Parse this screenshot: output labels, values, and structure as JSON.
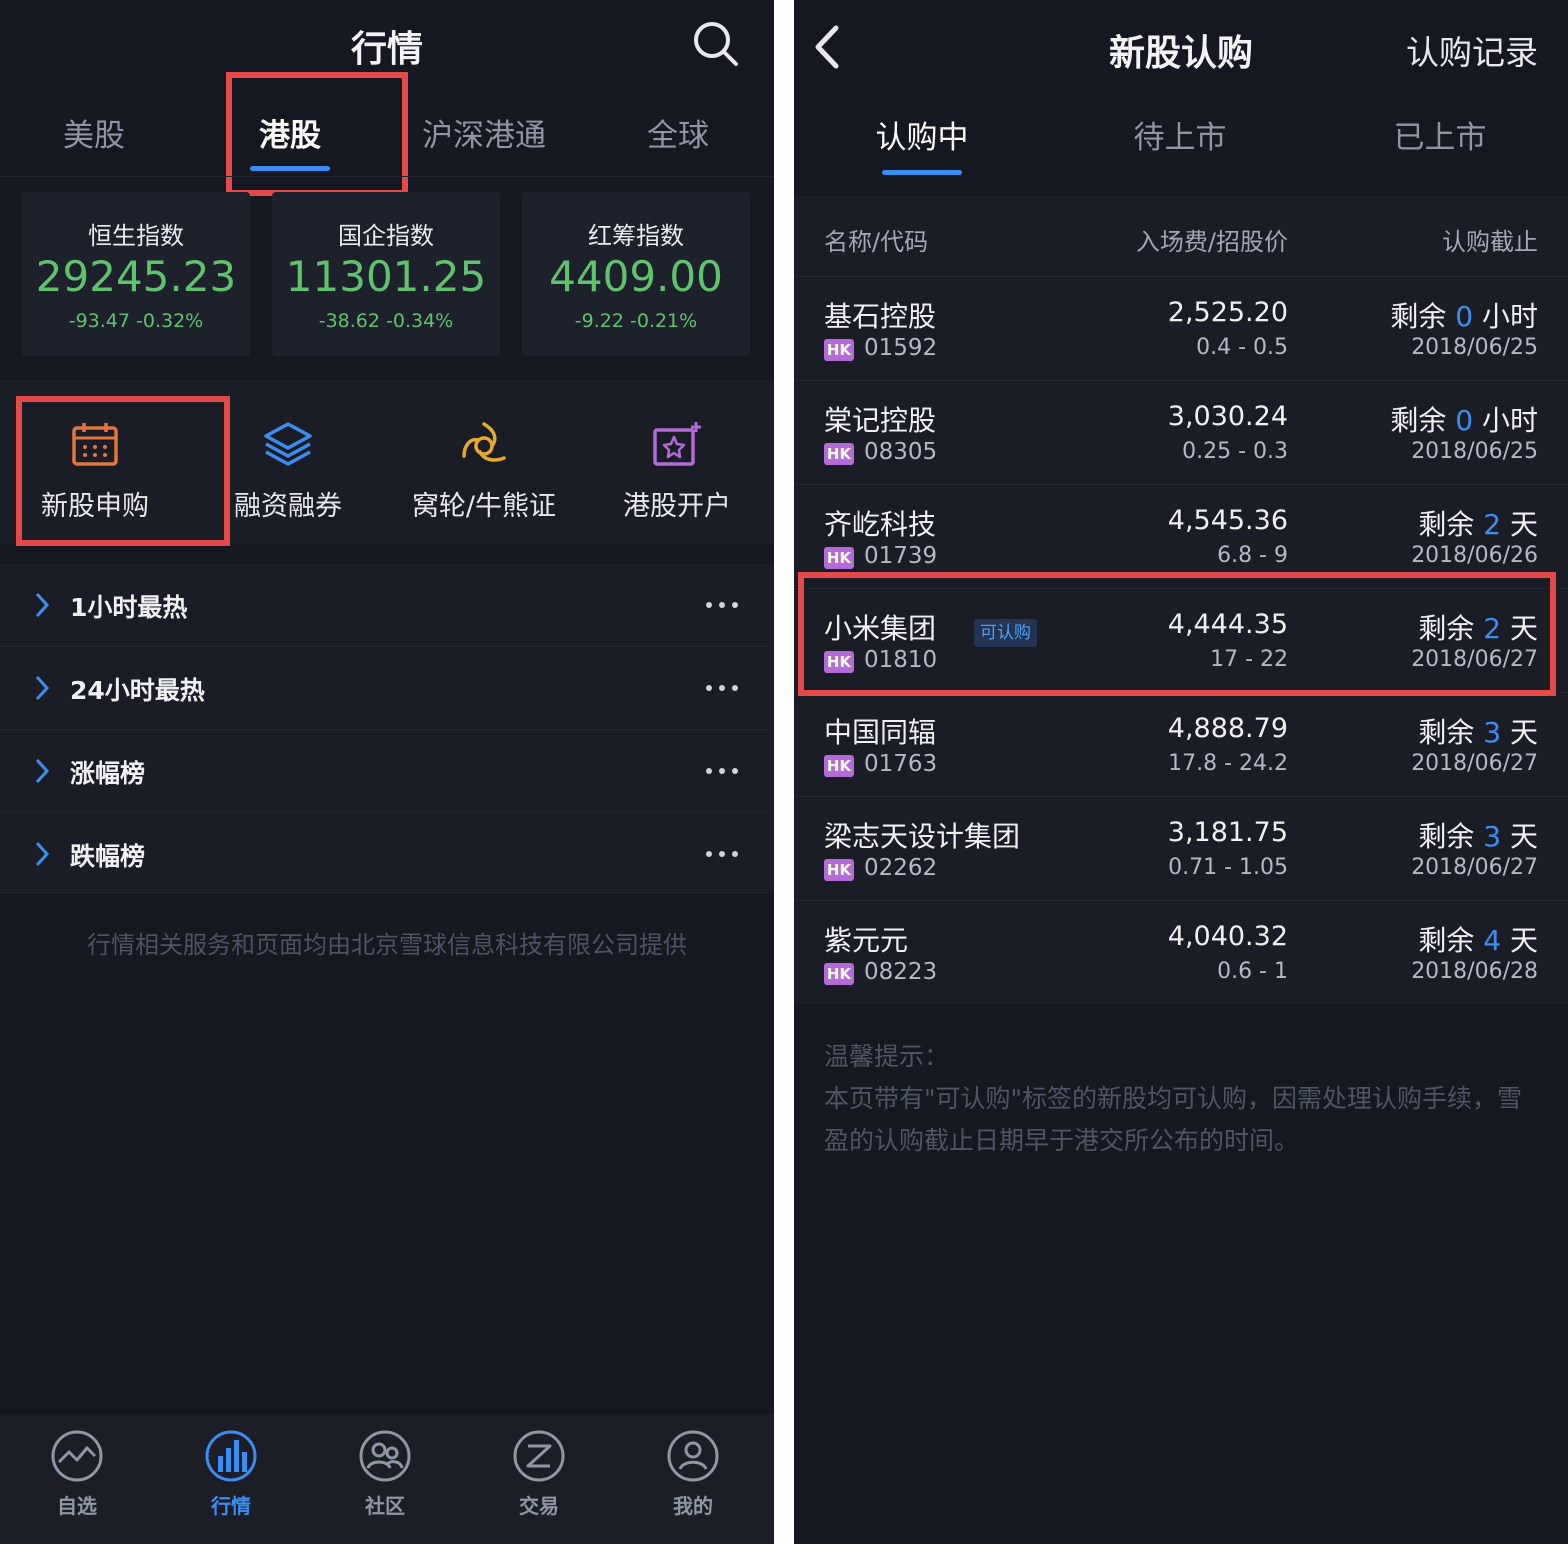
{
  "left": {
    "header": {
      "title": "行情"
    },
    "tabs": [
      {
        "label": "美股"
      },
      {
        "label": "港股"
      },
      {
        "label": "沪深港通"
      },
      {
        "label": "全球"
      }
    ],
    "indices": [
      {
        "name": "恒生指数",
        "value": "29245.23",
        "change": "-93.47  -0.32%"
      },
      {
        "name": "国企指数",
        "value": "11301.25",
        "change": "-38.62  -0.34%"
      },
      {
        "name": "红筹指数",
        "value": "4409.00",
        "change": "-9.22  -0.21%"
      }
    ],
    "shortcuts": [
      {
        "label": "新股申购",
        "icon": "calendar-icon"
      },
      {
        "label": "融资融券",
        "icon": "layers-icon"
      },
      {
        "label": "窝轮/牛熊证",
        "icon": "warrant-icon"
      },
      {
        "label": "港股开户",
        "icon": "account-open-icon"
      }
    ],
    "lists": [
      {
        "label": "1小时最热"
      },
      {
        "label": "24小时最热"
      },
      {
        "label": "涨幅榜"
      },
      {
        "label": "跌幅榜"
      }
    ],
    "provider_note": "行情相关服务和页面均由北京雪球信息科技有限公司提供",
    "tabbar": [
      {
        "label": "自选",
        "icon": "watchlist-icon"
      },
      {
        "label": "行情",
        "icon": "market-icon"
      },
      {
        "label": "社区",
        "icon": "community-icon"
      },
      {
        "label": "交易",
        "icon": "trade-icon"
      },
      {
        "label": "我的",
        "icon": "profile-icon"
      }
    ]
  },
  "right": {
    "header": {
      "title": "新股认购",
      "record": "认购记录"
    },
    "tabs": [
      {
        "label": "认购中"
      },
      {
        "label": "待上市"
      },
      {
        "label": "已上市"
      }
    ],
    "columns": {
      "name": "名称/代码",
      "fee": "入场费/招股价",
      "deadline": "认购截止"
    },
    "market_tag": "HK",
    "ipos": [
      {
        "name": "基石控股",
        "code": "01592",
        "fee": "2,525.20",
        "price": "0.4 - 0.5",
        "remain_prefix": "剩余 ",
        "remain_num": "0",
        "remain_unit": " 小时",
        "date": "2018/06/25",
        "badge": ""
      },
      {
        "name": "棠记控股",
        "code": "08305",
        "fee": "3,030.24",
        "price": "0.25 - 0.3",
        "remain_prefix": "剩余 ",
        "remain_num": "0",
        "remain_unit": " 小时",
        "date": "2018/06/25",
        "badge": ""
      },
      {
        "name": "齐屹科技",
        "code": "01739",
        "fee": "4,545.36",
        "price": "6.8 - 9",
        "remain_prefix": "剩余 ",
        "remain_num": "2",
        "remain_unit": " 天",
        "date": "2018/06/26",
        "badge": ""
      },
      {
        "name": "小米集团",
        "code": "01810",
        "fee": "4,444.35",
        "price": "17 - 22",
        "remain_prefix": "剩余 ",
        "remain_num": "2",
        "remain_unit": " 天",
        "date": "2018/06/27",
        "badge": "可认购"
      },
      {
        "name": "中国同辐",
        "code": "01763",
        "fee": "4,888.79",
        "price": "17.8 - 24.2",
        "remain_prefix": "剩余 ",
        "remain_num": "3",
        "remain_unit": " 天",
        "date": "2018/06/27",
        "badge": ""
      },
      {
        "name": "梁志天设计集团",
        "code": "02262",
        "fee": "3,181.75",
        "price": "0.71 - 1.05",
        "remain_prefix": "剩余 ",
        "remain_num": "3",
        "remain_unit": " 天",
        "date": "2018/06/27",
        "badge": ""
      },
      {
        "name": "紫元元",
        "code": "08223",
        "fee": "4,040.32",
        "price": "0.6 - 1",
        "remain_prefix": "剩余 ",
        "remain_num": "4",
        "remain_unit": " 天",
        "date": "2018/06/28",
        "badge": ""
      }
    ],
    "tips": {
      "title": "温馨提示：",
      "text": "本页带有\"可认购\"标签的新股均可认购，因需处理认购手续，雪盈的认购截止日期早于港交所公布的时间。"
    }
  },
  "colors": {
    "background": "#151821",
    "accent": "#3a8ef0",
    "down_green": "#5fc36d",
    "highlight_red": "#e54a4a",
    "hk_tag": "#b56ad8"
  }
}
